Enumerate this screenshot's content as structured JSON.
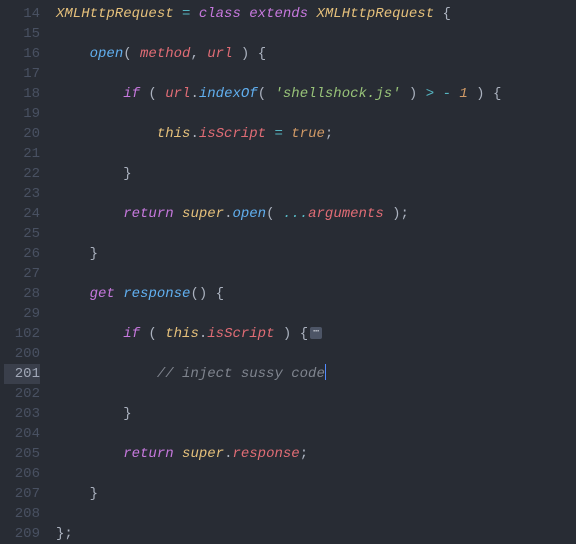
{
  "gutter": {
    "lines": [
      "14",
      "15",
      "16",
      "17",
      "18",
      "19",
      "20",
      "21",
      "22",
      "23",
      "24",
      "25",
      "26",
      "27",
      "28",
      "29",
      "102",
      "200",
      "201",
      "202",
      "203",
      "204",
      "205",
      "206",
      "207",
      "208",
      "209"
    ],
    "activeIndex": 18
  },
  "code": {
    "kw_class": "class",
    "kw_extends": "extends",
    "kw_return": "return",
    "kw_if": "if",
    "kw_get": "get",
    "kw_super": "super",
    "kw_this": "this",
    "kw_true": "true",
    "cls_XMLHttpRequest": "XMLHttpRequest",
    "fn_open": "open",
    "fn_indexOf": "indexOf",
    "fn_response": "response",
    "prop_isScript": "isScript",
    "prop_response": "response",
    "var_method": "method",
    "var_url": "url",
    "var_arguments": "arguments",
    "str_shellshock": "'shellshock.js'",
    "num_minus1": "1",
    "op_assign": "=",
    "op_gt": ">",
    "op_minus": "-",
    "op_spread": "...",
    "cmt_inject": "// inject sussy code",
    "fold": "⋯"
  }
}
